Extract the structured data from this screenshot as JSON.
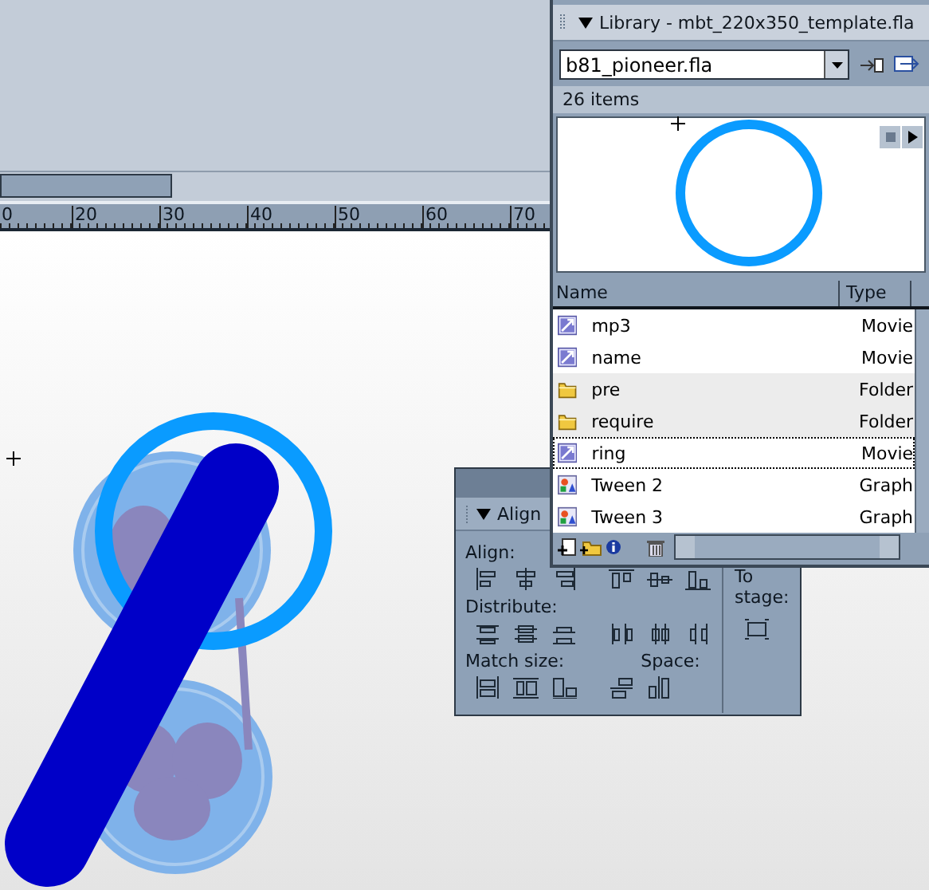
{
  "ruler": {
    "ticks": [
      "0",
      "20",
      "30",
      "40",
      "50",
      "60",
      "70"
    ]
  },
  "library": {
    "title": "Library - mbt_220x350_template.fla",
    "document": "b81_pioneer.fla",
    "item_count": "26 items",
    "columns": [
      "Name",
      "Type"
    ],
    "items": [
      {
        "name": "mp3",
        "type": "Movie",
        "kind": "movie",
        "selected": false,
        "highlighted": false
      },
      {
        "name": "name",
        "type": "Movie",
        "kind": "movie",
        "selected": false,
        "highlighted": false
      },
      {
        "name": "pre",
        "type": "Folder",
        "kind": "folder",
        "selected": false,
        "highlighted": true
      },
      {
        "name": "require",
        "type": "Folder",
        "kind": "folder",
        "selected": false,
        "highlighted": true
      },
      {
        "name": "ring",
        "type": "Movie",
        "kind": "movie",
        "selected": true,
        "highlighted": false
      },
      {
        "name": "Tween 2",
        "type": "Graph",
        "kind": "graphic",
        "selected": false,
        "highlighted": false
      },
      {
        "name": "Tween 3",
        "type": "Graph",
        "kind": "graphic",
        "selected": false,
        "highlighted": false
      }
    ]
  },
  "align": {
    "title": "Align",
    "align_label": "Align:",
    "distribute_label": "Distribute:",
    "match_size_label": "Match size:",
    "space_label": "Space:",
    "to_stage_label": "To stage:"
  }
}
